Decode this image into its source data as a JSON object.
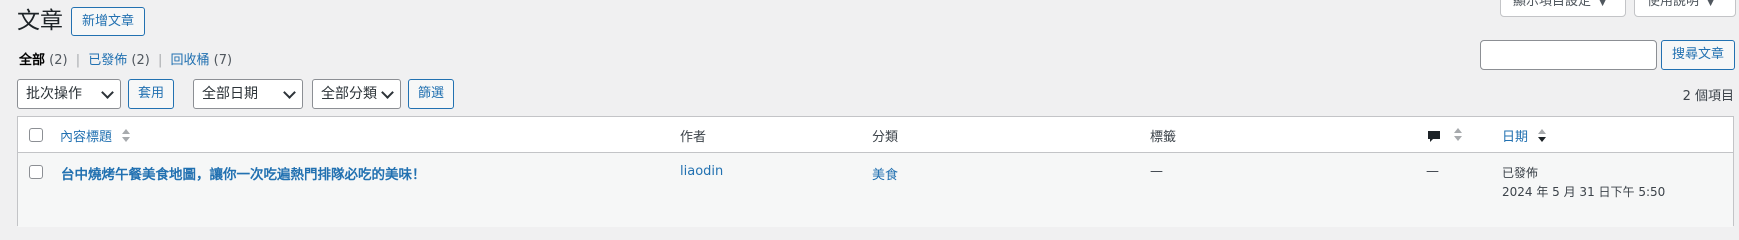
{
  "header": {
    "title": "文章",
    "add_new_label": "新增文章",
    "screen_options_label": "顯示項目設定",
    "help_label": "使用說明"
  },
  "filters": {
    "all_label": "全部",
    "all_count": "(2)",
    "published_label": "已發佈",
    "published_count": "(2)",
    "trash_label": "回收桶",
    "trash_count": "(7)",
    "separator": "|"
  },
  "search": {
    "value": "",
    "button_label": "搜尋文章"
  },
  "toolbar": {
    "bulk_action_selected": "批次操作",
    "apply_label": "套用",
    "date_filter_selected": "全部日期",
    "category_filter_selected": "全部分類",
    "filter_label": "篩選",
    "items_count": "2 個項目"
  },
  "table": {
    "columns": {
      "title": "內容標題",
      "author": "作者",
      "categories": "分類",
      "tags": "標籤",
      "comments_icon": "comment-bubble-icon",
      "date": "日期"
    },
    "rows": [
      {
        "title": "台中燒烤午餐美食地圖，讓你一次吃遍熱門排隊必吃的美味！",
        "author": "liaodin",
        "category": "美食",
        "tags": "—",
        "comments": "—",
        "status": "已發佈",
        "date": "2024 年 5 月 31 日下午 5:50"
      }
    ]
  },
  "colors": {
    "accent": "#2271b1",
    "background": "#f0f0f1",
    "border": "#c3c4c7",
    "text": "#3c434a"
  }
}
